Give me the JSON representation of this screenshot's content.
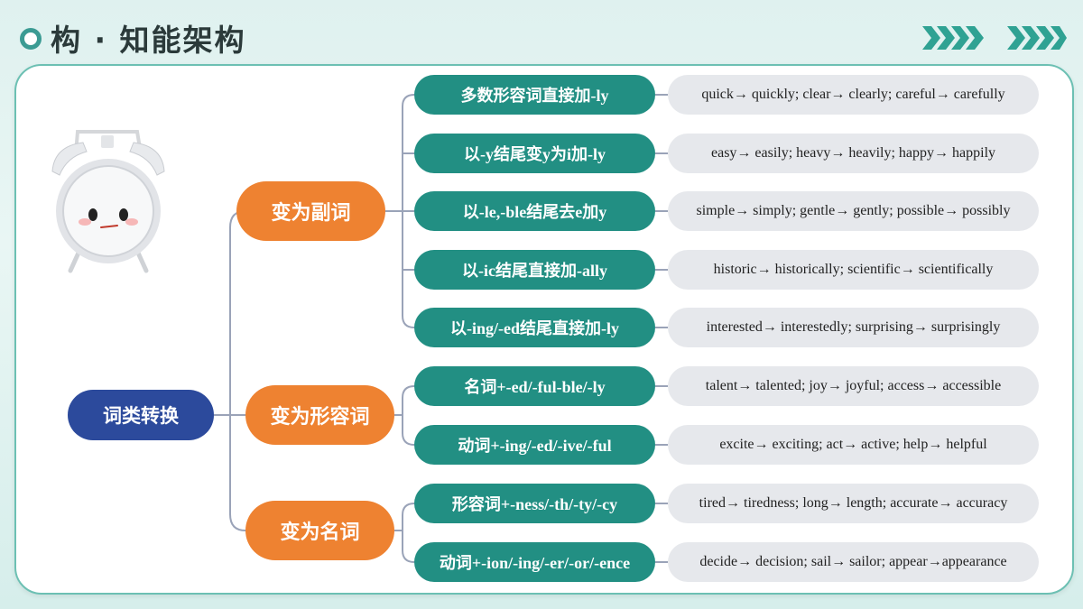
{
  "header": {
    "title": "构 · 知能架构"
  },
  "colors": {
    "teal": "#228f83",
    "orange": "#ee8231",
    "navy": "#2c4a9c",
    "example_bg": "#e6e8ec",
    "accent": "#3b9b93"
  },
  "icons": [
    "alarm-clock-icon",
    "chevron-arrows-icon"
  ],
  "mindmap": {
    "root": "词类转换",
    "categories": [
      "变为副词",
      "变为形容词",
      "变为名词"
    ],
    "rules": [
      "多数形容词直接加-ly",
      "以-y结尾变y为i加-ly",
      "以-le,-ble结尾去e加y",
      "以-ic结尾直接加-ally",
      "以-ing/-ed结尾直接加-ly",
      "名词+-ed/-ful-ble/-ly",
      "动词+-ing/-ed/-ive/-ful",
      "形容词+-ness/-th/-ty/-cy",
      "动词+-ion/-ing/-er/-or/-ence"
    ],
    "examples": [
      "quick→ quickly; clear→ clearly; careful→ carefully",
      "easy→ easily; heavy→ heavily; happy→ happily",
      "simple→ simply; gentle→ gently; possible→ possibly",
      "historic→ historically; scientific→ scientifically",
      "interested→ interestedly; surprising→ surprisingly",
      "talent→ talented; joy→ joyful; access→ accessible",
      "excite→ exciting; act→ active; help→ helpful",
      "tired→ tiredness; long→ length; accurate→ accuracy",
      "decide→ decision; sail→ sailor; appear→appearance"
    ]
  }
}
